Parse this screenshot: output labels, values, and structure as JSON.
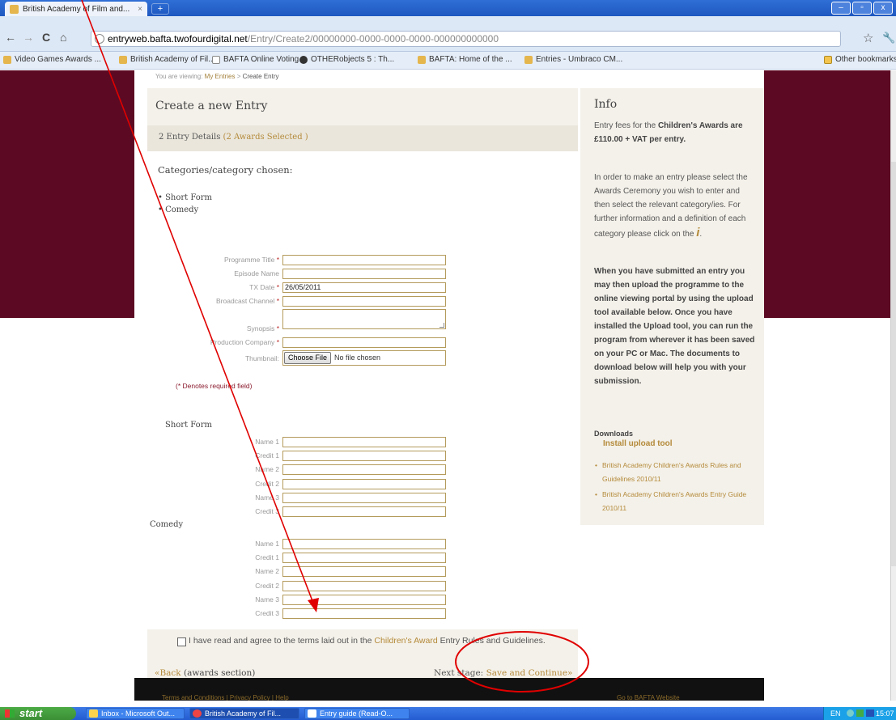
{
  "browser": {
    "tab_title": "British Academy of Film and...",
    "tab_close": "×",
    "new_tab": "+",
    "window_buttons": [
      "–",
      "▫",
      "x"
    ],
    "back": "←",
    "forward": "→",
    "reload": "C",
    "home": "⌂",
    "url_host": "entryweb.bafta.twofourdigital.net",
    "url_path": "/Entry/Create2/00000000-0000-0000-0000-000000000000",
    "star": "☆",
    "wrench": "🔧",
    "bookmarks": [
      "Video Games Awards ...",
      "British Academy of Fil...",
      "BAFTA Online Voting",
      "OTHERobjects 5 : Th...",
      "BAFTA: Home of the ...",
      "Entries - Umbraco CM..."
    ],
    "other_bookmarks": "Other bookmarks"
  },
  "breadcrumb": {
    "prefix": "You are viewing:",
    "link": "My Entries",
    "sep": ">",
    "current": "Create Entry"
  },
  "main": {
    "title": "Create a new Entry",
    "entry_details": "2 Entry Details",
    "awards_selected": "(2 Awards Selected )",
    "categories_title": "Categories/category chosen:",
    "categories": [
      "Short Form",
      "Comedy"
    ]
  },
  "form": {
    "programme_title": {
      "label": "Programme Title",
      "value": ""
    },
    "episode_name": {
      "label": "Episode Name",
      "value": ""
    },
    "tx_date": {
      "label": "TX Date",
      "value": "26/05/2011"
    },
    "broadcast_channel": {
      "label": "Broadcast Channel",
      "value": ""
    },
    "synopsis": {
      "label": "Synopsis",
      "value": ""
    },
    "production_company": {
      "label": "Production Company",
      "value": ""
    },
    "thumbnail": {
      "label": "Thumbnail:",
      "button": "Choose File",
      "status": "No file chosen"
    },
    "required_mark": "*",
    "required_note": "(* Denotes required field)"
  },
  "credits": [
    {
      "section": "Short Form",
      "fields": [
        "Name 1",
        "Credit 1",
        "Name 2",
        "Credit 2",
        "Name 3",
        "Credit 3"
      ]
    },
    {
      "section": "Comedy",
      "fields": [
        "Name 1",
        "Credit 1",
        "Name 2",
        "Credit 2",
        "Name 3",
        "Credit 3"
      ]
    }
  ],
  "agree": {
    "before": "I have read and agree to the terms laid out in the",
    "link": "Children's Award",
    "after": "Entry Rules and Guidelines."
  },
  "nav": {
    "back_arrow": "«",
    "back_link": "Back",
    "back_note": "(awards section)",
    "next_label": "Next stage:",
    "next_link": "Save and Continue",
    "next_arrow": "»"
  },
  "info": {
    "title": "Info",
    "fee_before": "Entry fees for the",
    "fee_bold": "Children's Awards are £110.00 + VAT per entry.",
    "p2": "In order to make an entry please select the Awards Ceremony you wish to enter and then select the relevant category/ies. For further information and a definition of each category please click on the",
    "info_icon": "i",
    "p3": "When you have submitted an entry you may then upload the programme to the online viewing portal by using the upload tool available below. Once you have installed the Upload tool, you can run the program from wherever it has been saved on your PC or Mac. The documents to download below will help you with your submission.",
    "downloads_title": "Downloads",
    "install_link": "Install upload tool",
    "documents": [
      "British Academy Children's Awards Rules and Guidelines 2010/11",
      "British Academy Children's Awards Entry Guide 2010/11"
    ]
  },
  "footer": {
    "links": "Terms and Conditions | Privacy Policy | Help",
    "bafta": "Go to BAFTA Website"
  },
  "taskbar": {
    "start": "start",
    "items": [
      "Inbox - Microsoft Out...",
      "British Academy of Fil...",
      "Entry guide (Read-O..."
    ],
    "lang": "EN",
    "time": "15:07"
  },
  "colors": {
    "maroon": "#5c0a23",
    "gold": "#b48a3a",
    "annotation": "#e00000"
  }
}
